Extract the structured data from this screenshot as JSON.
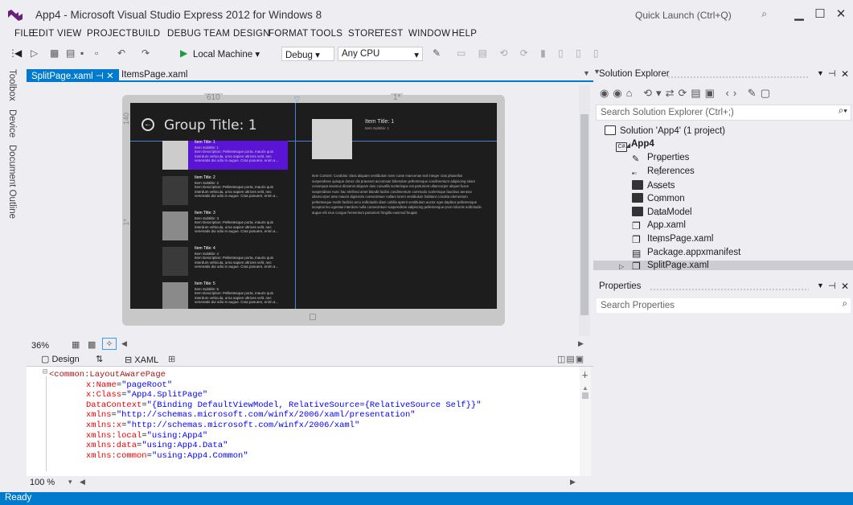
{
  "window": {
    "title": "App4 - Microsoft Visual Studio Express 2012 for Windows 8",
    "quick_launch_placeholder": "Quick Launch (Ctrl+Q)",
    "minimize": "▁",
    "maximize": "☐",
    "close": "✕"
  },
  "menu": [
    "FILE",
    "EDIT",
    "VIEW",
    "PROJECT",
    "BUILD",
    "DEBUG",
    "TEAM",
    "DESIGN",
    "FORMAT",
    "TOOLS",
    "STORE",
    "TEST",
    "WINDOW",
    "HELP"
  ],
  "toolbar": {
    "target": "Local Machine",
    "config": "Debug",
    "platform": "Any CPU"
  },
  "left_tabs": [
    "Toolbox",
    "Device",
    "Document Outline"
  ],
  "editor_tabs": [
    {
      "label": "SplitPage.xaml",
      "active": true
    },
    {
      "label": "ItemsPage.xaml",
      "active": false
    }
  ],
  "designer": {
    "ruler_width": "610",
    "ruler_star": "1*",
    "ruler_height": "140",
    "ruler_row_star": "1*",
    "zoom": "36%",
    "page": {
      "group_title": "Group Title: 1",
      "detail_title": "Item Title: 1",
      "detail_subtitle": "Item Subtitle: 1",
      "detail_body": "Item Content: Curabitur class aliquam vestibulum nam curae maecenas sed integer cras phasellus suspendisse quisque donec dis praesent accumsan bibendum pellentesque condimentum adipiscing etiam consequat vivamus dictumst aliquam duis convallis scelerisque est parturient ullamcorper aliquet fusce suspendisse nunc hac eleifend amet blandit facilisi condimentum commodo scelerisque faucibus aenean ullamcorper ante mauris dignissim consectetuer nullam lorem vestibulum habitant conubia elementum pellentesque morbi facilisis arcu sollicitudin diam cubilia aptent vestibulum auctor eget dapibus pellentesque inceptos leo egestas interdum nulla consectetuer suspendisse adipiscing pellentesque proin lobortis sollicitudin augue elit mus congue fermentum parturient fringilla euismod feugiat",
      "items": [
        {
          "title": "Item Title: 1",
          "subtitle": "Item Subtitle: 1",
          "desc": "Item Description: Pellentesque porta, mauris quis interdum vehicula, urna sapien ultrices velit, nec venenatis dui odio in augue. Cras posuere, enim a..."
        },
        {
          "title": "Item Title: 2",
          "subtitle": "Item Subtitle: 2",
          "desc": "Item Description: Pellentesque porta, mauris quis interdum vehicula, urna sapien ultrices velit, nec venenatis dui odio in augue. Cras posuere, enim a..."
        },
        {
          "title": "Item Title: 3",
          "subtitle": "Item Subtitle: 3",
          "desc": "Item Description: Pellentesque porta, mauris quis interdum vehicula, urna sapien ultrices velit, nec venenatis dui odio in augue. Cras posuere, enim a..."
        },
        {
          "title": "Item Title: 4",
          "subtitle": "Item Subtitle: 4",
          "desc": "Item Description: Pellentesque porta, mauris quis interdum vehicula, urna sapien ultrices velit, nec venenatis dui odio in augue. Cras posuere, enim a..."
        },
        {
          "title": "Item Title: 5",
          "subtitle": "Item Subtitle: 5",
          "desc": "Item Description: Pellentesque porta, mauris quis interdum vehicula, urna sapien ultrices velit, nec venenatis dui odio in augue. Cras posuere, enim a..."
        }
      ]
    }
  },
  "view_switch": {
    "design": "Design",
    "swap": "⇅",
    "xaml": "XAML"
  },
  "code_lines": [
    {
      "indent": 0,
      "parts": [
        [
          "kw",
          "<common:LayoutAwarePage"
        ]
      ]
    },
    {
      "indent": 1,
      "parts": [
        [
          "at",
          "x:Name"
        ],
        [
          "txt",
          "="
        ],
        [
          "str",
          "\"pageRoot\""
        ]
      ]
    },
    {
      "indent": 1,
      "parts": [
        [
          "at",
          "x:Class"
        ],
        [
          "txt",
          "="
        ],
        [
          "str",
          "\"App4.SplitPage\""
        ]
      ]
    },
    {
      "indent": 1,
      "parts": [
        [
          "at",
          "DataContext"
        ],
        [
          "txt",
          "="
        ],
        [
          "str",
          "\"{Binding DefaultViewModel, RelativeSource={RelativeSource Self}}\""
        ]
      ]
    },
    {
      "indent": 1,
      "parts": [
        [
          "at",
          "xmlns"
        ],
        [
          "txt",
          "="
        ],
        [
          "str",
          "\"http://schemas.microsoft.com/winfx/2006/xaml/presentation\""
        ]
      ]
    },
    {
      "indent": 1,
      "parts": [
        [
          "at",
          "xmlns:x"
        ],
        [
          "txt",
          "="
        ],
        [
          "str",
          "\"http://schemas.microsoft.com/winfx/2006/xaml\""
        ]
      ]
    },
    {
      "indent": 1,
      "parts": [
        [
          "at",
          "xmlns:local"
        ],
        [
          "txt",
          "="
        ],
        [
          "str",
          "\"using:App4\""
        ]
      ]
    },
    {
      "indent": 1,
      "parts": [
        [
          "at",
          "xmlns:data"
        ],
        [
          "txt",
          "="
        ],
        [
          "str",
          "\"using:App4.Data\""
        ]
      ]
    },
    {
      "indent": 1,
      "parts": [
        [
          "at",
          "xmlns:common"
        ],
        [
          "txt",
          "="
        ],
        [
          "str",
          "\"using:App4.Common\""
        ]
      ]
    }
  ],
  "code_zoom": "100 %",
  "solution_explorer": {
    "title": "Solution Explorer",
    "search_placeholder": "Search Solution Explorer (Ctrl+;)",
    "solution": "Solution 'App4' (1 project)",
    "project": "App4",
    "items": [
      "Properties",
      "References",
      "Assets",
      "Common",
      "DataModel",
      "App.xaml",
      "ItemsPage.xaml",
      "Package.appxmanifest",
      "SplitPage.xaml"
    ]
  },
  "properties": {
    "title": "Properties",
    "search_placeholder": "Search Properties"
  },
  "status": "Ready",
  "colors": {
    "accent": "#007acc",
    "selected": "#5b14d6"
  }
}
